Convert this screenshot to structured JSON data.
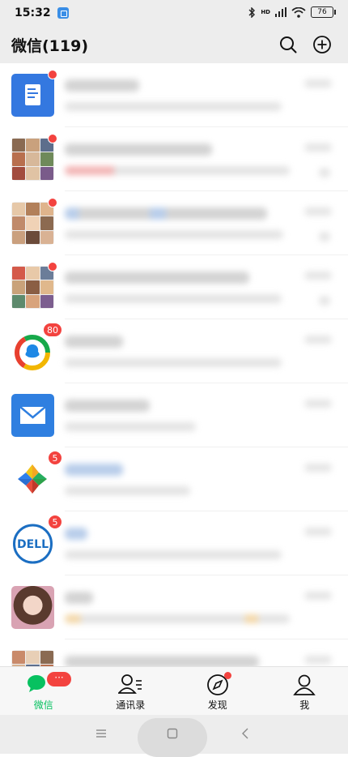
{
  "status_bar": {
    "time": "15:32",
    "signal_text": "HD",
    "battery": "76"
  },
  "header": {
    "title": "微信(119)"
  },
  "chats": [
    {
      "avatar": "doc-icon",
      "badge": "",
      "color": "#3478e0"
    },
    {
      "avatar": "group-grid",
      "badge": "",
      "color": ""
    },
    {
      "avatar": "group-grid",
      "badge": "",
      "color": ""
    },
    {
      "avatar": "group-grid",
      "badge": "",
      "color": ""
    },
    {
      "avatar": "qq-browser-icon",
      "badge": "80",
      "color": ""
    },
    {
      "avatar": "mail-icon",
      "badge": "",
      "color": "#2f7fe0"
    },
    {
      "avatar": "pinwheel-icon",
      "badge": "5",
      "color": ""
    },
    {
      "avatar": "dell-logo",
      "badge": "5",
      "color": "#1b6ec2"
    },
    {
      "avatar": "photo",
      "badge": "",
      "color": ""
    },
    {
      "avatar": "group-grid",
      "badge": "",
      "color": ""
    }
  ],
  "dell_logo_text": "DELL",
  "tabs": [
    {
      "label": "微信",
      "badge": "···",
      "active": true
    },
    {
      "label": "通讯录",
      "badge": "",
      "active": false
    },
    {
      "label": "发现",
      "badge": "",
      "active": false
    },
    {
      "label": "我",
      "badge": "",
      "active": false
    }
  ],
  "colors": {
    "accent": "#07c160",
    "badge": "#f3433f",
    "bar": "#ededed"
  }
}
